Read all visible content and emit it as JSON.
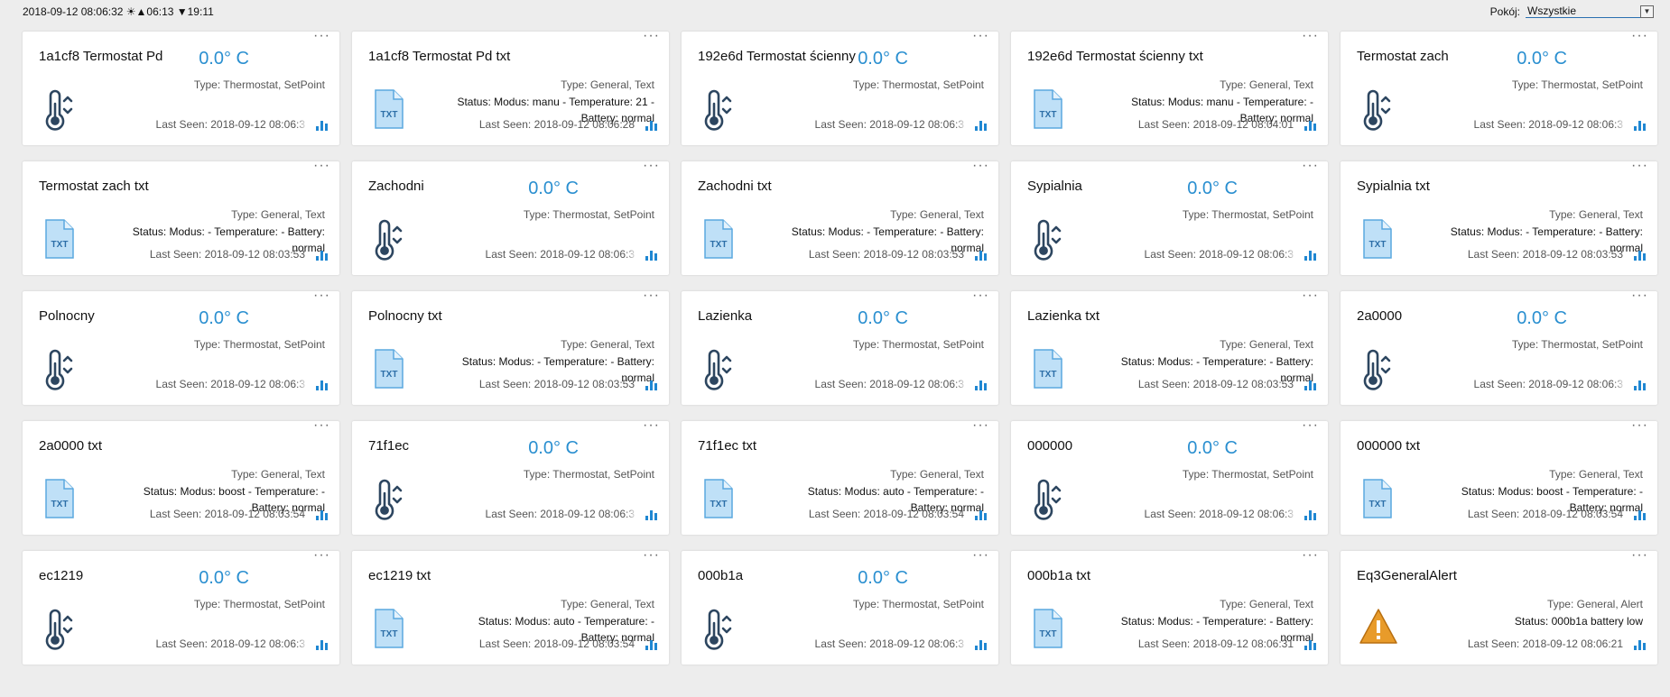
{
  "header": {
    "clock": "2018-09-12 08:06:32 ☀▲06:13 ▼19:11",
    "room_label": "Pokój:",
    "room_value": "Wszystkie"
  },
  "colors": {
    "accent": "#2a8fd0",
    "icon_dark": "#2d4660",
    "file_icon": "#a9d3f2",
    "alert": "#e89b2a"
  },
  "devices": [
    {
      "name": "1a1cf8 Termostat Pd",
      "kind": "thermostat",
      "temp": "0.0° C",
      "type": "Type: Thermostat, SetPoint",
      "last_seen": "Last Seen: 2018-09-12 08:06:3"
    },
    {
      "name": "1a1cf8 Termostat Pd txt",
      "kind": "text",
      "type": "Type: General, Text",
      "status": "Status: Modus: manu - Temperature: 21 - Battery: normal",
      "last_seen": "Last Seen: 2018-09-12 08:06:28"
    },
    {
      "name": "192e6d Termostat ścienny",
      "kind": "thermostat",
      "temp": "0.0° C",
      "type": "Type: Thermostat, SetPoint",
      "last_seen": "Last Seen: 2018-09-12 08:06:3"
    },
    {
      "name": "192e6d Termostat ścienny txt",
      "kind": "text",
      "type": "Type: General, Text",
      "status": "Status: Modus: manu - Temperature: - Battery: normal",
      "last_seen": "Last Seen: 2018-09-12 08:04:01"
    },
    {
      "name": "Termostat zach",
      "kind": "thermostat",
      "temp": "0.0° C",
      "type": "Type: Thermostat, SetPoint",
      "last_seen": "Last Seen: 2018-09-12 08:06:3"
    },
    {
      "name": "Termostat zach txt",
      "kind": "text",
      "type": "Type: General, Text",
      "status": "Status: Modus: - Temperature: - Battery: normal",
      "last_seen": "Last Seen: 2018-09-12 08:03:53"
    },
    {
      "name": "Zachodni",
      "kind": "thermostat",
      "temp": "0.0° C",
      "type": "Type: Thermostat, SetPoint",
      "last_seen": "Last Seen: 2018-09-12 08:06:3"
    },
    {
      "name": "Zachodni txt",
      "kind": "text",
      "type": "Type: General, Text",
      "status": "Status: Modus: - Temperature: - Battery: normal",
      "last_seen": "Last Seen: 2018-09-12 08:03:53"
    },
    {
      "name": "Sypialnia",
      "kind": "thermostat",
      "temp": "0.0° C",
      "type": "Type: Thermostat, SetPoint",
      "last_seen": "Last Seen: 2018-09-12 08:06:3"
    },
    {
      "name": "Sypialnia txt",
      "kind": "text",
      "type": "Type: General, Text",
      "status": "Status: Modus: - Temperature: - Battery: normal",
      "last_seen": "Last Seen: 2018-09-12 08:03:53"
    },
    {
      "name": "Polnocny",
      "kind": "thermostat",
      "temp": "0.0° C",
      "type": "Type: Thermostat, SetPoint",
      "last_seen": "Last Seen: 2018-09-12 08:06:3"
    },
    {
      "name": "Polnocny txt",
      "kind": "text",
      "type": "Type: General, Text",
      "status": "Status: Modus: - Temperature: - Battery: normal",
      "last_seen": "Last Seen: 2018-09-12 08:03:53"
    },
    {
      "name": "Lazienka",
      "kind": "thermostat",
      "temp": "0.0° C",
      "type": "Type: Thermostat, SetPoint",
      "last_seen": "Last Seen: 2018-09-12 08:06:3"
    },
    {
      "name": "Lazienka txt",
      "kind": "text",
      "type": "Type: General, Text",
      "status": "Status: Modus: - Temperature: - Battery: normal",
      "last_seen": "Last Seen: 2018-09-12 08:03:53"
    },
    {
      "name": "2a0000",
      "kind": "thermostat",
      "temp": "0.0° C",
      "type": "Type: Thermostat, SetPoint",
      "last_seen": "Last Seen: 2018-09-12 08:06:3"
    },
    {
      "name": "2a0000 txt",
      "kind": "text",
      "type": "Type: General, Text",
      "status": "Status: Modus: boost - Temperature: - Battery: normal",
      "last_seen": "Last Seen: 2018-09-12 08:03:54"
    },
    {
      "name": "71f1ec",
      "kind": "thermostat",
      "temp": "0.0° C",
      "type": "Type: Thermostat, SetPoint",
      "last_seen": "Last Seen: 2018-09-12 08:06:3"
    },
    {
      "name": "71f1ec txt",
      "kind": "text",
      "type": "Type: General, Text",
      "status": "Status: Modus: auto - Temperature: - Battery: normal",
      "last_seen": "Last Seen: 2018-09-12 08:03:54"
    },
    {
      "name": "000000",
      "kind": "thermostat",
      "temp": "0.0° C",
      "type": "Type: Thermostat, SetPoint",
      "last_seen": "Last Seen: 2018-09-12 08:06:3"
    },
    {
      "name": "000000 txt",
      "kind": "text",
      "type": "Type: General, Text",
      "status": "Status: Modus: boost - Temperature: - Battery: normal",
      "last_seen": "Last Seen: 2018-09-12 08:03:54"
    },
    {
      "name": "ec1219",
      "kind": "thermostat",
      "temp": "0.0° C",
      "type": "Type: Thermostat, SetPoint",
      "last_seen": "Last Seen: 2018-09-12 08:06:3"
    },
    {
      "name": "ec1219 txt",
      "kind": "text",
      "type": "Type: General, Text",
      "status": "Status: Modus: auto - Temperature: - Battery: normal",
      "last_seen": "Last Seen: 2018-09-12 08:03:54"
    },
    {
      "name": "000b1a",
      "kind": "thermostat",
      "temp": "0.0° C",
      "type": "Type: Thermostat, SetPoint",
      "last_seen": "Last Seen: 2018-09-12 08:06:3"
    },
    {
      "name": "000b1a txt",
      "kind": "text",
      "type": "Type: General, Text",
      "status": "Status: Modus: - Temperature: - Battery: normal",
      "last_seen": "Last Seen: 2018-09-12 08:06:31"
    },
    {
      "name": "Eq3GeneralAlert",
      "kind": "alert",
      "type": "Type: General, Alert",
      "status": "Status: 000b1a battery low",
      "last_seen": "Last Seen: 2018-09-12 08:06:21"
    }
  ]
}
